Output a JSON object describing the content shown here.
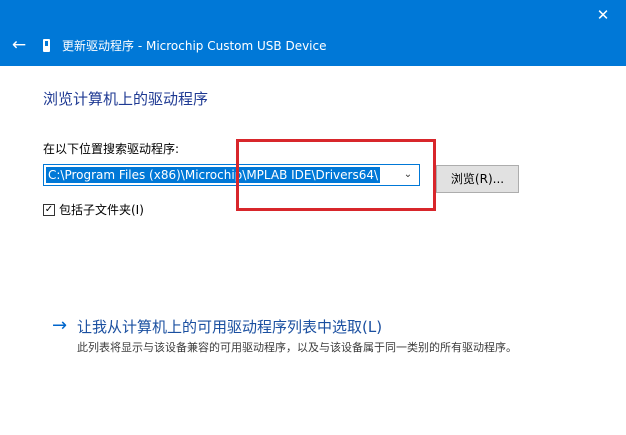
{
  "window": {
    "title": "更新驱动程序 - Microchip Custom USB Device",
    "close_glyph": "✕",
    "back_glyph": "←"
  },
  "main": {
    "heading": "浏览计算机上的驱动程序",
    "search_label": "在以下位置搜索驱动程序:",
    "path_value": "C:\\Program Files (x86)\\Microchip\\MPLAB IDE\\Drivers64\\",
    "browse_label": "浏览(R)...",
    "include_subfolders_label": "包括子文件夹(I)",
    "include_subfolders_checked": true,
    "checkbox_glyph": "✓",
    "dropdown_glyph": "⌄"
  },
  "pick_option": {
    "arrow_glyph": "→",
    "title": "让我从计算机上的可用驱动程序列表中选取(L)",
    "description": "此列表将显示与该设备兼容的可用驱动程序，以及与该设备属于同一类别的所有驱动程序。"
  },
  "colors": {
    "title_bar": "#0078d7",
    "annotation": "#d8262b",
    "link": "#1a4fa0"
  }
}
